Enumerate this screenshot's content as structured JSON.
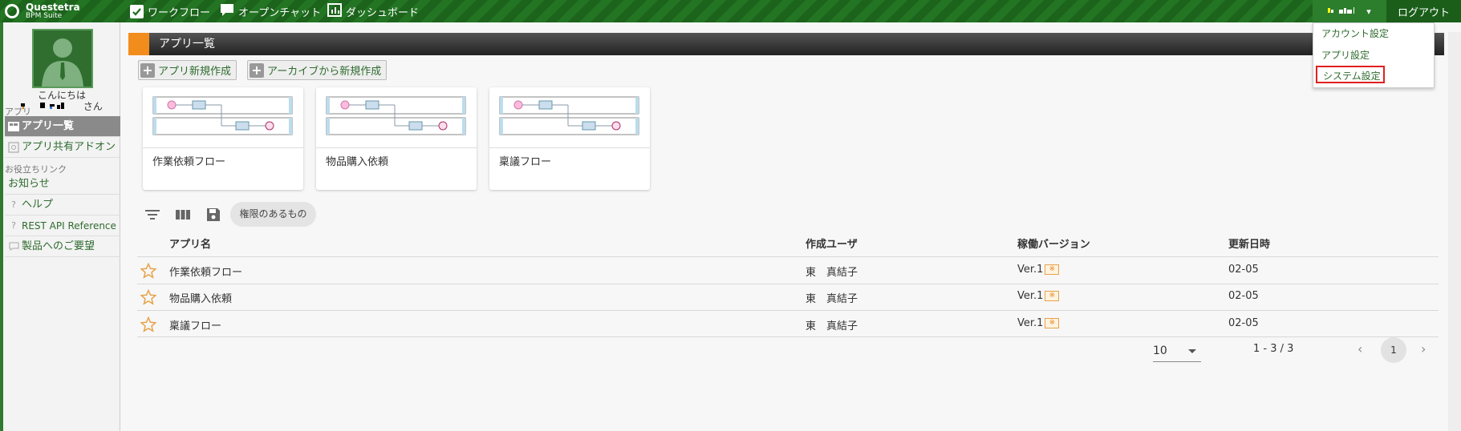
{
  "header": {
    "logo_line1": "Questetra",
    "logo_line2": "BPM Suite",
    "nav": [
      {
        "label": "ワークフロー",
        "icon": "checkbox-icon"
      },
      {
        "label": "オープンチャット",
        "icon": "chat-bubble-icon"
      },
      {
        "label": "ダッシュボード",
        "icon": "dashboard-icon"
      }
    ],
    "user_menu_label": "▾",
    "logout_label": "ログアウト"
  },
  "dropdown": {
    "items": [
      "アカウント設定",
      "アプリ設定",
      "システム設定"
    ],
    "highlighted": "システム設定",
    "highlight_color": "#e02020"
  },
  "sidebar": {
    "greeting": "こんにちは",
    "greeting_suffix": "さん",
    "section_apps": "アプリ",
    "app_items": [
      {
        "label": "アプリ一覧",
        "icon": "app-list-icon",
        "active": true
      },
      {
        "label": "アプリ共有アドオン",
        "icon": "addon-icon",
        "active": false
      }
    ],
    "section_links": "お役立ちリンク",
    "link_items": [
      {
        "label": "お知らせ",
        "icon": ""
      },
      {
        "label": "ヘルプ",
        "icon": "help-icon"
      },
      {
        "label": "REST API Reference",
        "icon": "help-icon"
      },
      {
        "label": "製品へのご要望",
        "icon": "feedback-icon"
      }
    ]
  },
  "main": {
    "panel_title": "アプリ一覧",
    "accent_color": "#f28c1c",
    "buttons": [
      "アプリ新規作成",
      "アーカイブから新規作成"
    ],
    "cards": [
      "作業依頼フロー",
      "物品購入依頼",
      "稟議フロー"
    ],
    "filter_chip": "権限のあるもの",
    "table": {
      "columns": [
        "アプリ名",
        "作成ユーザ",
        "稼働バージョン",
        "更新日時"
      ],
      "rows": [
        {
          "name": "作業依頼フロー",
          "user": "東　真結子",
          "version": "Ver.1",
          "updated": "02-05"
        },
        {
          "name": "物品購入依頼",
          "user": "東　真結子",
          "version": "Ver.1",
          "updated": "02-05"
        },
        {
          "name": "稟議フロー",
          "user": "東　真結子",
          "version": "Ver.1",
          "updated": "02-05"
        }
      ]
    },
    "pagination": {
      "per_page": "10",
      "range": "1 - 3 / 3",
      "current_page": "1",
      "prev": "‹",
      "next": "›"
    }
  },
  "colors": {
    "topbar": "#1f6a1f",
    "link": "#2e6b2e",
    "star": "#e8a24a"
  }
}
